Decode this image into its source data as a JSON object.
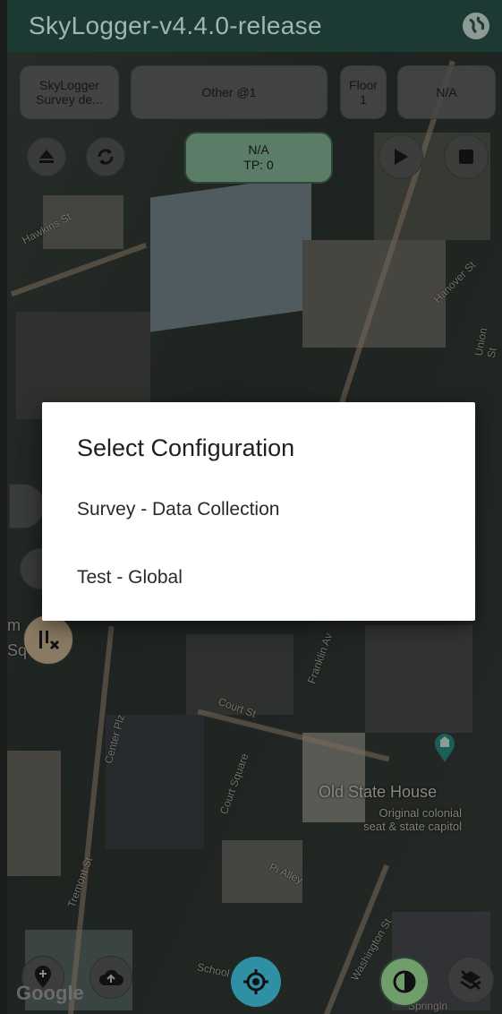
{
  "app_bar": {
    "title": "SkyLogger-v4.4.0-release",
    "globe_icon": "globe-icon"
  },
  "chips": {
    "survey": "SkyLogger\nSurvey de...",
    "other": "Other @1",
    "floor": "Floor\n1",
    "na": "N/A"
  },
  "status": {
    "line1": "N/A",
    "line2": "TP: 0"
  },
  "map_labels": {
    "hawkins": "Hawkins St",
    "hanover": "Hanover St",
    "union": "Union St",
    "franklin": "Franklin Av",
    "court_st": "Court St",
    "court_square": "Court Square",
    "center_plz": "Center Plz",
    "tremont": "Tremont St",
    "pi_alley": "Pi Alley",
    "washington": "Washington St",
    "school": "School",
    "springin": "Springln",
    "poi_title": "Old State House",
    "poi_sub1": "Original colonial",
    "poi_sub2": "seat & state capitol",
    "m_text": "m",
    "squ_text": "Squ",
    "google": "Google"
  },
  "dialog": {
    "title": "Select Configuration",
    "options": [
      "Survey - Data Collection",
      "Test - Global"
    ]
  },
  "colors": {
    "app_bar_bg": "#1c3a33",
    "status_bg": "#5b7d68",
    "locate_fab": "#2f8fa5",
    "contrast_fab": "#6f9e6a"
  }
}
